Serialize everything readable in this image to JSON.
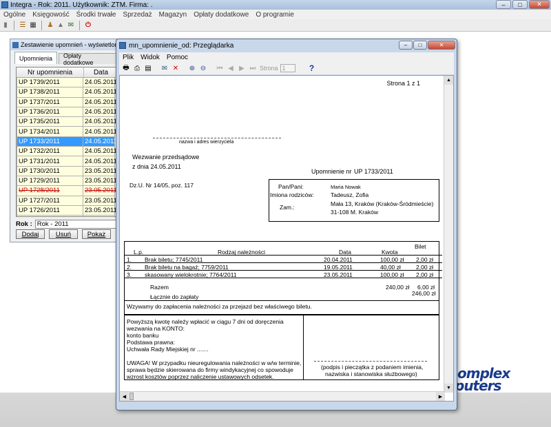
{
  "app": {
    "title": "Integra -  Rok: 2011. Użytkownik: ZTM. Firma: .",
    "menu": [
      "Ogólne",
      "Księgowość",
      "Środki trwałe",
      "Sprzedaż",
      "Magazyn",
      "Opłaty dodatkowe",
      "O programie"
    ],
    "logo_line1": "omplex",
    "logo_line2": "puters"
  },
  "listwin": {
    "title": "Zestawienie upomnień - wyświetlone elem",
    "tabs": [
      "Upomnienia",
      "Opłaty dodatkowe"
    ],
    "columns": [
      "Nr upomnienia",
      "Data"
    ],
    "rows": [
      {
        "nr": "UP 1739/2011",
        "data": "24.05.2011"
      },
      {
        "nr": "UP 1738/2011",
        "data": "24.05.2011"
      },
      {
        "nr": "UP 1737/2011",
        "data": "24.05.2011"
      },
      {
        "nr": "UP 1736/2011",
        "data": "24.05.2011"
      },
      {
        "nr": "UP 1735/2011",
        "data": "24.05.2011"
      },
      {
        "nr": "UP 1734/2011",
        "data": "24.05.2011"
      },
      {
        "nr": "UP 1733/2011",
        "data": "24.05.2011"
      },
      {
        "nr": "UP 1732/2011",
        "data": "24.05.2011"
      },
      {
        "nr": "UP 1731/2011",
        "data": "24.05.2011"
      },
      {
        "nr": "UP 1730/2011",
        "data": "23.05.2011"
      },
      {
        "nr": "UP 1729/2011",
        "data": "23.05.2011"
      },
      {
        "nr": "UP 1728/2011",
        "data": "23.05.2011"
      },
      {
        "nr": "UP 1727/2011",
        "data": "23.05.2011"
      },
      {
        "nr": "UP 1726/2011",
        "data": "23.05.2011"
      },
      {
        "nr": "",
        "data": ""
      }
    ],
    "selected_row": 6,
    "strikethrough_row": 11,
    "rok_label": "Rok :",
    "rok_value": "Rok - 2011",
    "buttons": [
      "Dodaj",
      "Usuń",
      "Pokaż"
    ]
  },
  "viewer": {
    "title": "mn_upomnienie_od: Przeglądarka",
    "menu": [
      "Plik",
      "Widok",
      "Pomoc"
    ],
    "strona_label": "Strona",
    "strona_value": "1",
    "help": "?"
  },
  "doc": {
    "page_indicator": "Strona 1 z 1",
    "creditor_caption": "nazwa i adres wierzyciela",
    "wezwanie": "Wezwanie przedsądowe",
    "z_dnia": "z dnia 24.05.2011",
    "upomnienie_label": "Upomnienie nr",
    "upomnienie_nr": "UP 1733/2011",
    "dzu": "Dz.U. Nr 14/05, poz. 117",
    "panpani_label": "Pan/Pani:",
    "panpani_value": "Maria Nowak",
    "imiona_label": "Imiona rodziców:",
    "imiona_value": "Tadeusz, Zofia",
    "zam_label": "Zam.:",
    "zam_line1": "Mała 13, Kraków (Kraków-Śródmieście)",
    "zam_line2": "31-108 M. Kraków",
    "table_headers": {
      "lp": "L.p.",
      "rodzaj": "Rodzaj należności",
      "data": "Data",
      "kwota": "Kwota",
      "bilet": "Bilet"
    },
    "items": [
      {
        "lp": "1.",
        "rodzaj": "Brak biletu; 7745/2011",
        "data": "20.04.2011",
        "kwota": "100,00 zł",
        "bilet": "2,00 zł"
      },
      {
        "lp": "2.",
        "rodzaj": "Brak biletu na bagaż; 7759/2011",
        "data": "19.05.2011",
        "kwota": "40,00 zł",
        "bilet": "2,00 zł"
      },
      {
        "lp": "3.",
        "rodzaj": "skasowany wielokrotnie; 7764/2011",
        "data": "23.05.2011",
        "kwota": "100,00 zł",
        "bilet": "2,00 zł"
      }
    ],
    "razem_label": "Razem",
    "razem_kwota": "240,00 zł",
    "razem_bilet": "6,00 zł",
    "lacznie_label": "Łącznie do zapłaty",
    "lacznie_value": "246,00 zł",
    "wzywamy": "Wzywamy do zapłacenia należności za przejazd bez właściwego biletu.",
    "pay_lines": [
      "Powyższą kwotę należy wpłacić w ciągu 7 dni od doręczenia",
      "wezwania na KONTO:",
      "konto banku",
      "Podstawa prawna:",
      "Uchwała Rady Miejskiej nr ......."
    ],
    "uwaga_lines": [
      "UWAGA! W przypadku nieuregulowania należności w w/w terminie,",
      "sprawa będzie skierowana do firmy windykacyjnej co spowoduje",
      "wzrost kosztów poprzez naliczenie ustawowych odsetek."
    ],
    "podpis_line1": "(podpis i pieczątka z podaniem imienia,",
    "podpis_line2": "nazwiska i stanowiska służbowego)"
  }
}
